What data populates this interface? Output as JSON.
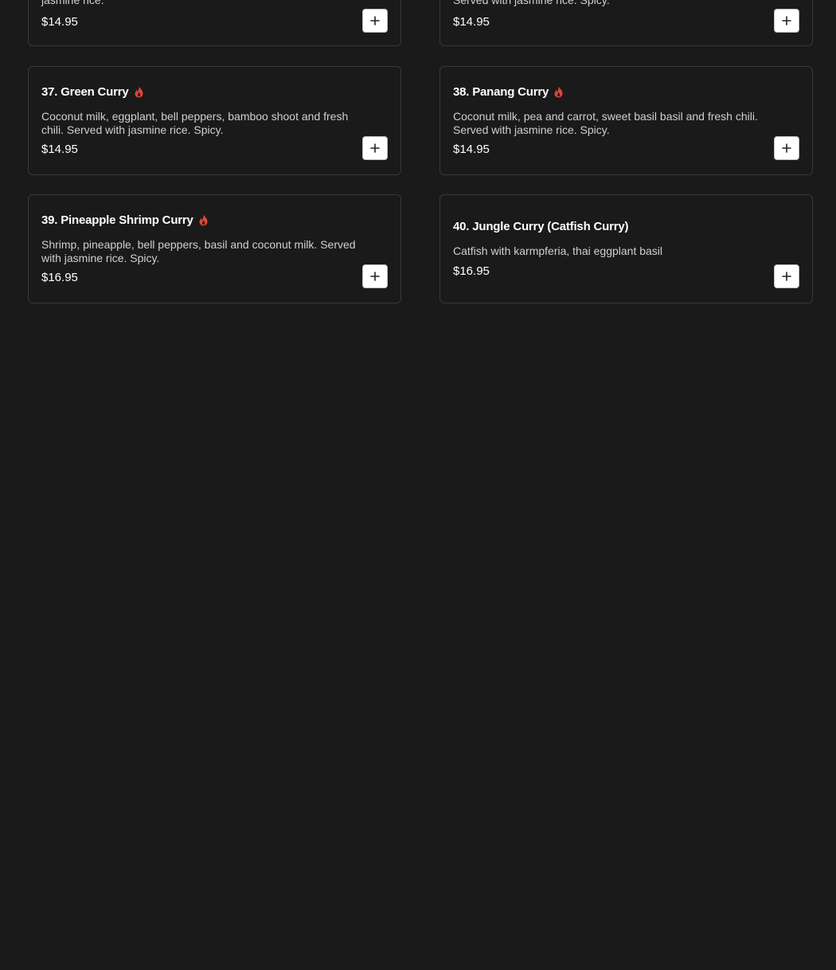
{
  "colors": {
    "background": "#1a1a1a",
    "card_border": "#383838",
    "text": "#ffffff",
    "muted_text": "#d0d0d0",
    "spicy": "#e0443a"
  },
  "items": [
    {
      "title": "",
      "description": "jasmine rice.",
      "price": "$14.95",
      "spicy": false,
      "add_icon": "plus-icon"
    },
    {
      "title": "",
      "description": "Served with jasmine rice. Spicy.",
      "price": "$14.95",
      "spicy": false,
      "add_icon": "plus-icon"
    },
    {
      "title": "37. Green Curry",
      "description": "Coconut milk, eggplant, bell peppers, bamboo shoot and fresh chili. Served with jasmine rice. Spicy.",
      "price": "$14.95",
      "spicy": true,
      "spicy_icon": "chili-flame-icon",
      "add_icon": "plus-icon"
    },
    {
      "title": "38. Panang Curry",
      "description": "Coconut milk, pea and carrot, sweet basil basil and fresh chili. Served with jasmine rice. Spicy.",
      "price": "$14.95",
      "spicy": true,
      "spicy_icon": "chili-flame-icon",
      "add_icon": "plus-icon"
    },
    {
      "title": "39. Pineapple Shrimp Curry",
      "description": "Shrimp, pineapple, bell peppers, basil and coconut milk. Served with jasmine rice. Spicy.",
      "price": "$16.95",
      "spicy": true,
      "spicy_icon": "chili-flame-icon",
      "add_icon": "plus-icon"
    },
    {
      "title": "40. Jungle Curry (Catfish Curry)",
      "description": "Catfish with karmpferia, thai eggplant basil",
      "price": "$16.95",
      "spicy": false,
      "add_icon": "plus-icon"
    }
  ]
}
